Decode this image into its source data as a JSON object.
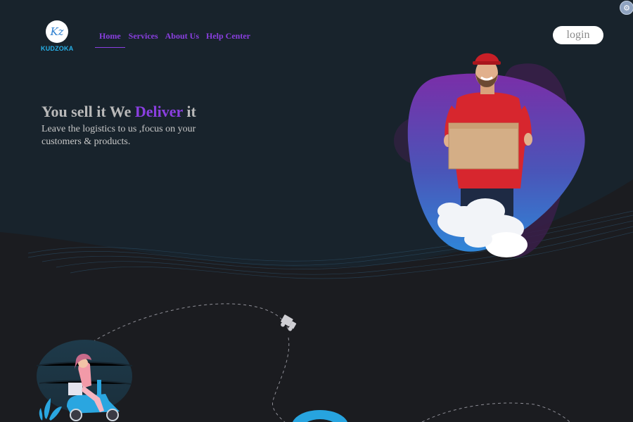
{
  "brand": {
    "logo_monogram": "Kz",
    "name": "KUDZOKA"
  },
  "nav": {
    "items": [
      {
        "label": "Home",
        "active": true
      },
      {
        "label": "Services",
        "active": false
      },
      {
        "label": "About Us",
        "active": false
      },
      {
        "label": "Help Center",
        "active": false
      }
    ]
  },
  "header": {
    "login_label": "login"
  },
  "hero": {
    "headline_part1": "You sell it We ",
    "headline_accent": "Deliver",
    "headline_part2": " it",
    "subline": "Leave the logistics to us ,focus on your customers & products."
  },
  "colors": {
    "accent": "#8a3fe0",
    "hero_bg": "#18232c",
    "page_bg": "#1b1c20",
    "brand_blue": "#27b0e8"
  },
  "icons": {
    "corner": "settings-badge-icon",
    "truck": "delivery-truck-icon"
  }
}
